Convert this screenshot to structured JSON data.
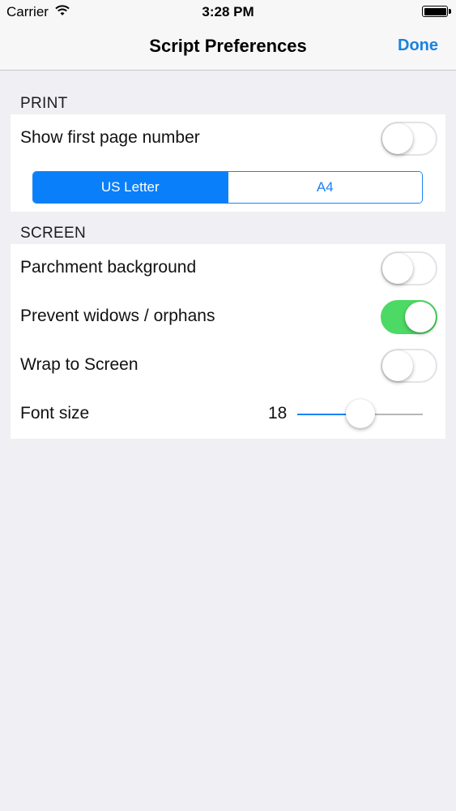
{
  "status_bar": {
    "carrier": "Carrier",
    "time": "3:28 PM",
    "wifi_icon": "wifi-icon",
    "battery_icon": "battery-icon"
  },
  "nav": {
    "title": "Script Preferences",
    "done_label": "Done",
    "accent_color": "#1a82e0"
  },
  "print_section": {
    "header": "PRINT",
    "show_first_page_number": {
      "label": "Show first page number",
      "on": false
    },
    "paper_size": {
      "options": [
        "US Letter",
        "A4"
      ],
      "selected": "US Letter"
    }
  },
  "screen_section": {
    "header": "SCREEN",
    "parchment_background": {
      "label": "Parchment background",
      "on": false
    },
    "prevent_widows": {
      "label": "Prevent widows / orphans",
      "on": true
    },
    "wrap_to_screen": {
      "label": "Wrap to Screen",
      "on": false
    },
    "font_size": {
      "label": "Font size",
      "value": "18",
      "slider_fraction": 0.5
    }
  },
  "colors": {
    "switch_on": "#4cd964",
    "segment_selected": "#0a7ffa",
    "background": "#efeff4"
  }
}
